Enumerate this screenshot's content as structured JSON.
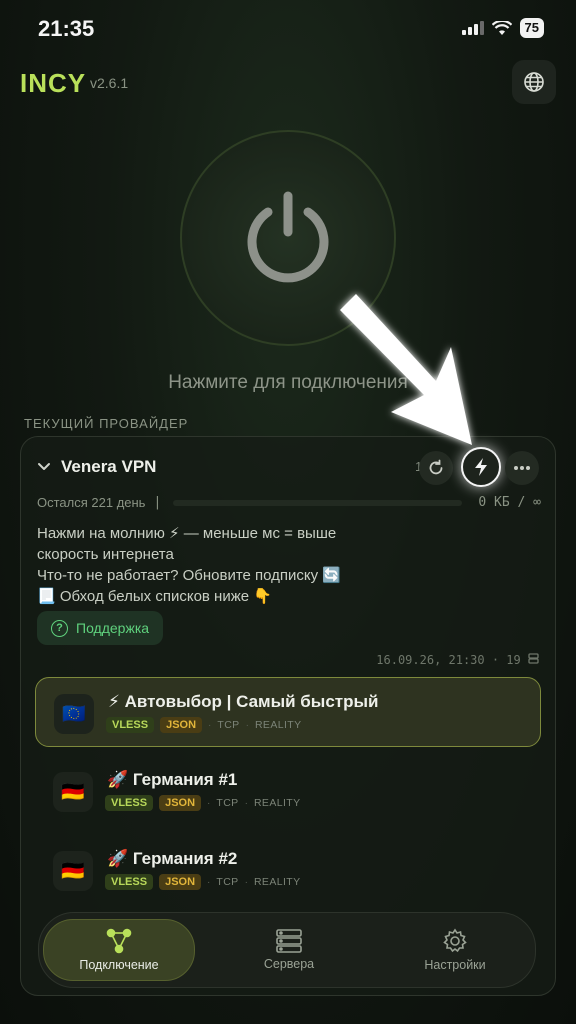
{
  "status_bar": {
    "time": "21:35",
    "battery": "75"
  },
  "app": {
    "logo": "INCY",
    "version": "v2.6.1"
  },
  "header": {
    "globe_icon": "globe-icon"
  },
  "power": {
    "hint": "Нажмите для подключения"
  },
  "section_label": "ТЕКУЩИЙ ПРОВАЙДЕР",
  "provider": {
    "name": "Venera VPN",
    "age": "1ч",
    "days_left": "Остался 221 день",
    "days_sep": "|",
    "traffic": "0 КБ / ∞",
    "description": [
      "Нажми на молнию ⚡ — меньше мс = выше",
      "скорость интернета",
      "Что-то не работает? Обновите подписку 🔄",
      "📃 Обход белых списков ниже 👇"
    ],
    "support_label": "Поддержка",
    "support_icon_glyph": "?",
    "updated": "16.09.26, 21:30 · 19"
  },
  "servers": [
    {
      "flag": "🇪🇺",
      "name": "⚡ Автовыбор | Самый быстрый",
      "tag1": "VLESS",
      "tag2": "JSON",
      "transport": "TCP",
      "security": "REALITY",
      "sep": "·",
      "selected": true
    },
    {
      "flag": "🇩🇪",
      "name": "🚀 Германия #1",
      "tag1": "VLESS",
      "tag2": "JSON",
      "transport": "TCP",
      "security": "REALITY",
      "sep": "·",
      "selected": false
    },
    {
      "flag": "🇩🇪",
      "name": "🚀 Германия #2",
      "tag1": "VLESS",
      "tag2": "JSON",
      "transport": "TCP",
      "security": "REALITY",
      "sep": "·",
      "selected": false
    }
  ],
  "nav": {
    "connection": "Подключение",
    "servers": "Сервера",
    "settings": "Настройки"
  },
  "colors": {
    "accent": "#b9e05a",
    "support": "#5fd17d",
    "selected_border": "#7e8a3c"
  }
}
